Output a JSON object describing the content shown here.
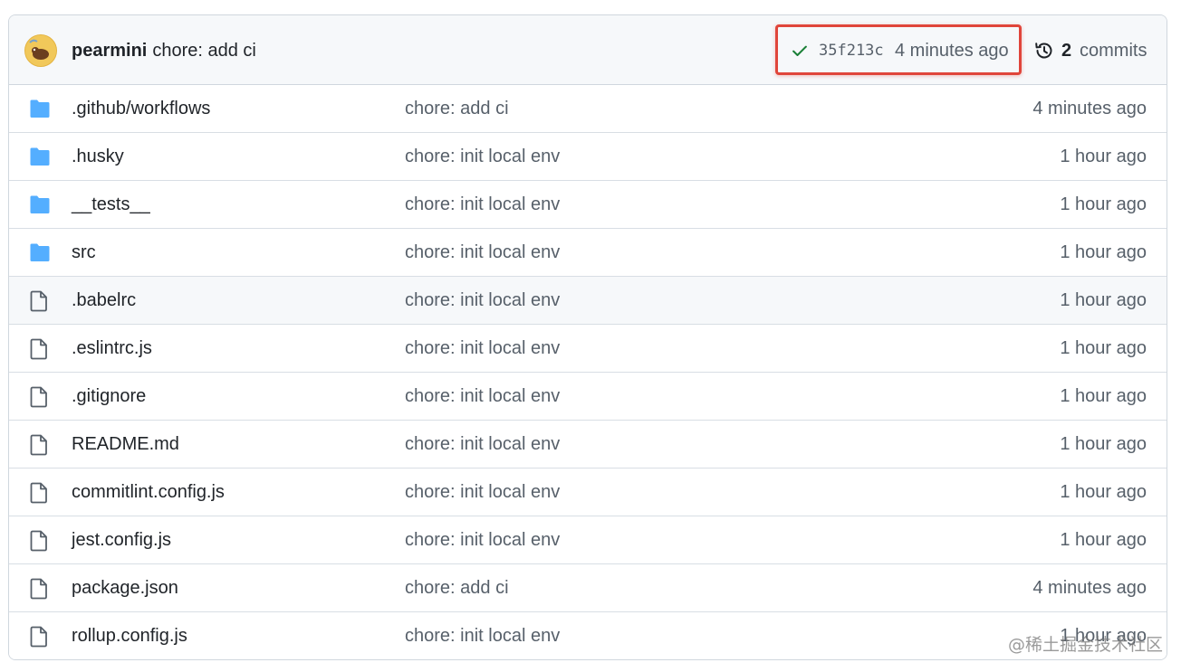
{
  "latest_commit": {
    "author": "pearmini",
    "message": "chore: add ci",
    "sha": "35f213c",
    "time": "4 minutes ago",
    "status_icon": "check-icon",
    "status_color": "#1a7f37",
    "highlight_color": "#e0453a"
  },
  "history": {
    "count": "2",
    "label": "commits",
    "icon": "history-icon"
  },
  "files": [
    {
      "type": "folder",
      "name": ".github/workflows",
      "message": "chore: add ci",
      "time": "4 minutes ago"
    },
    {
      "type": "folder",
      "name": ".husky",
      "message": "chore: init local env",
      "time": "1 hour ago"
    },
    {
      "type": "folder",
      "name": "__tests__",
      "message": "chore: init local env",
      "time": "1 hour ago"
    },
    {
      "type": "folder",
      "name": "src",
      "message": "chore: init local env",
      "time": "1 hour ago"
    },
    {
      "type": "file",
      "name": ".babelrc",
      "message": "chore: init local env",
      "time": "1 hour ago"
    },
    {
      "type": "file",
      "name": ".eslintrc.js",
      "message": "chore: init local env",
      "time": "1 hour ago"
    },
    {
      "type": "file",
      "name": ".gitignore",
      "message": "chore: init local env",
      "time": "1 hour ago"
    },
    {
      "type": "file",
      "name": "README.md",
      "message": "chore: init local env",
      "time": "1 hour ago"
    },
    {
      "type": "file",
      "name": "commitlint.config.js",
      "message": "chore: init local env",
      "time": "1 hour ago"
    },
    {
      "type": "file",
      "name": "jest.config.js",
      "message": "chore: init local env",
      "time": "1 hour ago"
    },
    {
      "type": "file",
      "name": "package.json",
      "message": "chore: add ci",
      "time": "4 minutes ago"
    },
    {
      "type": "file",
      "name": "rollup.config.js",
      "message": "chore: init local env",
      "time": "1 hour ago"
    }
  ],
  "colors": {
    "folder_icon": "#54aeff",
    "file_icon": "#57606a",
    "muted_text": "#57606a",
    "header_bg": "#f6f8fa"
  },
  "watermark": "@稀土掘金技术社区"
}
